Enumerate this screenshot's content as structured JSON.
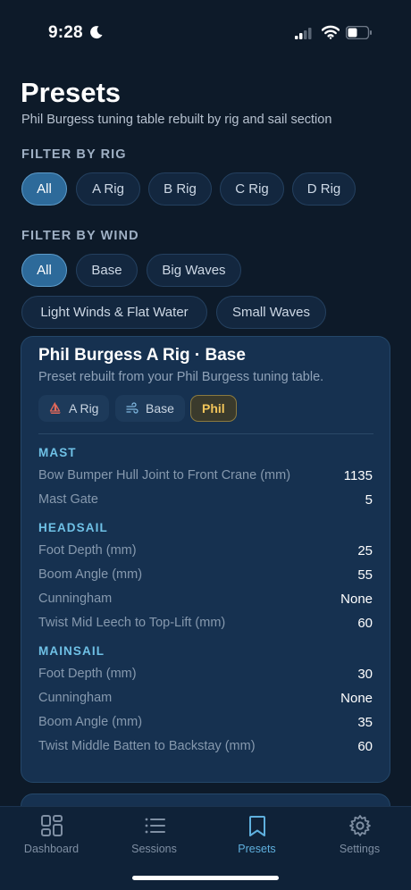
{
  "status": {
    "time": "9:28"
  },
  "header": {
    "title": "Presets",
    "subtitle": "Phil Burgess tuning table rebuilt by rig and sail section"
  },
  "filters": {
    "rig_label": "FILTER BY RIG",
    "rig_options": [
      "All",
      "A Rig",
      "B Rig",
      "C Rig",
      "D Rig"
    ],
    "rig_selected": "All",
    "wind_label": "FILTER BY WIND",
    "wind_options": [
      "All",
      "Base",
      "Big Waves",
      "Light Winds & Flat Water",
      "Small Waves"
    ],
    "wind_selected": "All"
  },
  "card": {
    "title": "Phil Burgess A Rig · Base",
    "subtitle": "Preset rebuilt from your Phil Burgess tuning table.",
    "tags": [
      {
        "label": "A Rig",
        "icon": "sailboat-icon"
      },
      {
        "label": "Base",
        "icon": "wind-icon"
      },
      {
        "label": "Phil",
        "icon": ""
      }
    ],
    "sections": [
      {
        "heading": "MAST",
        "rows": [
          {
            "label": "Bow Bumper Hull Joint to Front Crane (mm)",
            "value": "1135"
          },
          {
            "label": "Mast Gate",
            "value": "5"
          }
        ]
      },
      {
        "heading": "HEADSAIL",
        "rows": [
          {
            "label": "Foot Depth (mm)",
            "value": "25"
          },
          {
            "label": "Boom Angle (mm)",
            "value": "55"
          },
          {
            "label": "Cunningham",
            "value": "None"
          },
          {
            "label": "Twist Mid Leech to Top-Lift (mm)",
            "value": "60"
          }
        ]
      },
      {
        "heading": "MAINSAIL",
        "rows": [
          {
            "label": "Foot Depth (mm)",
            "value": "30"
          },
          {
            "label": "Cunningham",
            "value": "None"
          },
          {
            "label": "Boom Angle (mm)",
            "value": "35"
          },
          {
            "label": "Twist Middle Batten to Backstay (mm)",
            "value": "60"
          }
        ]
      }
    ]
  },
  "tabs": [
    {
      "label": "Dashboard",
      "icon": "dashboard-icon"
    },
    {
      "label": "Sessions",
      "icon": "list-icon"
    },
    {
      "label": "Presets",
      "icon": "bookmark-icon",
      "active": true
    },
    {
      "label": "Settings",
      "icon": "gear-icon"
    }
  ],
  "colors": {
    "background": "#0d1a29",
    "card": "#163150",
    "accent": "#5fb0de",
    "chip_active": "#2d6a9a",
    "tag_phil": "#f2c55a",
    "section_heading": "#6fc1e6"
  }
}
